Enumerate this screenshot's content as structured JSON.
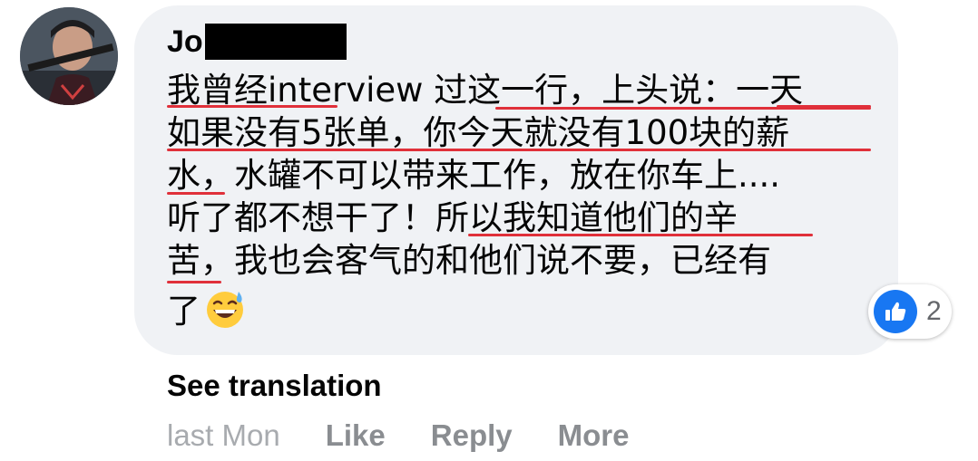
{
  "comment": {
    "author_visible": "Jo",
    "lines": [
      "我曾经interview 过这一行，上头说：一天",
      "如果没有5张单，你今天就没有100块的薪",
      "水，水罐不可以带来工作，放在你车上....",
      "听了都不想干了！所以我知道他们的辛",
      "苦，我也会客气的和他们说不要，已经有",
      "了"
    ],
    "emoji": "grinning-face-with-sweat",
    "underline_color": "#e0303a"
  },
  "reactions": {
    "icon": "thumbs-up-icon",
    "count": "2",
    "color": "#1877f2"
  },
  "see_translation": "See translation",
  "actions": {
    "timestamp": "last Mon",
    "like": "Like",
    "reply": "Reply",
    "more": "More"
  },
  "colors": {
    "bubble": "#f0f2f5",
    "text": "#050505",
    "secondary": "#8a8d91"
  }
}
